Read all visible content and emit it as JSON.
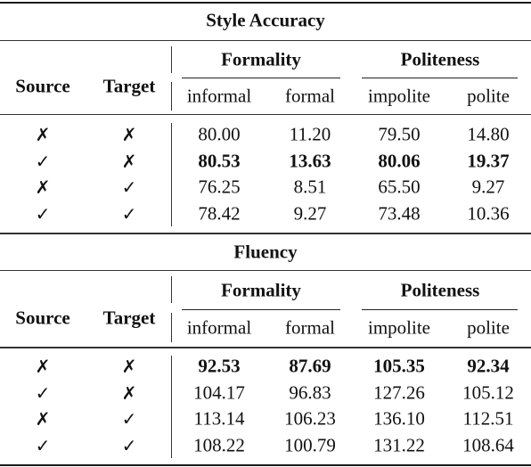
{
  "sections": [
    {
      "title": "Style Accuracy",
      "row_headers": [
        "Source",
        "Target"
      ],
      "groups": [
        {
          "label": "Formality",
          "subcolumns": [
            "informal",
            "formal"
          ]
        },
        {
          "label": "Politeness",
          "subcolumns": [
            "impolite",
            "polite"
          ]
        }
      ],
      "rows": [
        {
          "source": "✗",
          "target": "✗",
          "values": [
            "80.00",
            "11.20",
            "79.50",
            "14.80"
          ],
          "bold": false
        },
        {
          "source": "✓",
          "target": "✗",
          "values": [
            "80.53",
            "13.63",
            "80.06",
            "19.37"
          ],
          "bold": true
        },
        {
          "source": "✗",
          "target": "✓",
          "values": [
            "76.25",
            "8.51",
            "65.50",
            "9.27"
          ],
          "bold": false
        },
        {
          "source": "✓",
          "target": "✓",
          "values": [
            "78.42",
            "9.27",
            "73.48",
            "10.36"
          ],
          "bold": false
        }
      ]
    },
    {
      "title": "Fluency",
      "row_headers": [
        "Source",
        "Target"
      ],
      "groups": [
        {
          "label": "Formality",
          "subcolumns": [
            "informal",
            "formal"
          ]
        },
        {
          "label": "Politeness",
          "subcolumns": [
            "impolite",
            "polite"
          ]
        }
      ],
      "rows": [
        {
          "source": "✗",
          "target": "✗",
          "values": [
            "92.53",
            "87.69",
            "105.35",
            "92.34"
          ],
          "bold": true
        },
        {
          "source": "✓",
          "target": "✗",
          "values": [
            "104.17",
            "96.83",
            "127.26",
            "105.12"
          ],
          "bold": false
        },
        {
          "source": "✗",
          "target": "✓",
          "values": [
            "113.14",
            "106.23",
            "136.10",
            "112.51"
          ],
          "bold": false
        },
        {
          "source": "✓",
          "target": "✓",
          "values": [
            "108.22",
            "100.79",
            "131.22",
            "108.64"
          ],
          "bold": false
        }
      ]
    }
  ]
}
